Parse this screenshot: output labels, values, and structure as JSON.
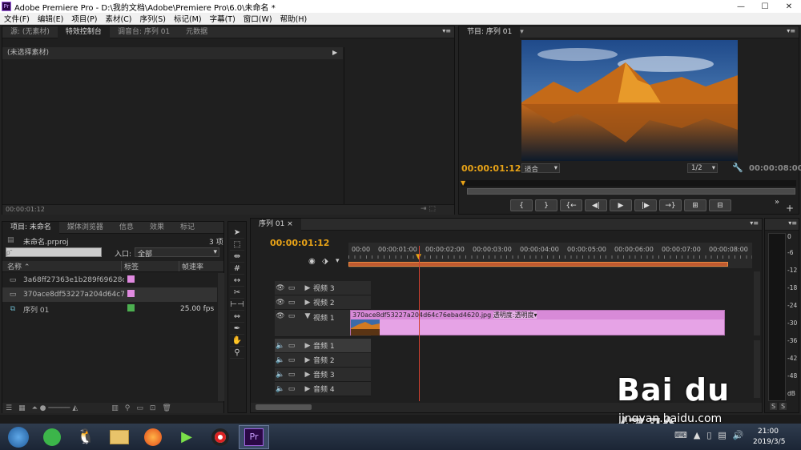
{
  "window": {
    "title": "Adobe Premiere Pro - D:\\我的文档\\Adobe\\Premiere Pro\\6.0\\未命名 *",
    "logo": "Pr",
    "minimize": "—",
    "maximize": "☐",
    "close": "✕"
  },
  "menu": [
    "文件(F)",
    "编辑(E)",
    "项目(P)",
    "素材(C)",
    "序列(S)",
    "标记(M)",
    "字幕(T)",
    "窗口(W)",
    "帮助(H)"
  ],
  "source_panel": {
    "tabs": [
      "源: (无素材)",
      "特效控制台",
      "调音台: 序列 01",
      "元数据"
    ],
    "no_clip": "(未选择素材)",
    "timecode": "00:00:01:12"
  },
  "program_monitor": {
    "tab": "节目: 序列 01",
    "timecode": "00:00:01:12",
    "fit": "适合",
    "ratio": "1/2",
    "duration": "00:00:08:00",
    "buttons": [
      "{",
      "}",
      "{←",
      "◀|",
      "▶",
      "|▶",
      "→}",
      "⊞",
      "⊟"
    ],
    "more": "»",
    "add": "+"
  },
  "project_panel": {
    "tabs": [
      "项目: 未命名",
      "媒体浏览器",
      "信息",
      "效果",
      "标记"
    ],
    "file": "未命名.prproj",
    "count": "3 项",
    "search_placeholder": "ρ˜",
    "entry_label": "入口:",
    "entry_value": "全部",
    "columns": {
      "name": "名称",
      "label": "标签",
      "fps": "帧速率"
    },
    "items": [
      {
        "name": "3a68ff27363e1b289f69628c",
        "color": "#e08ae0",
        "fps": ""
      },
      {
        "name": "370ace8df53227a204d64c7",
        "color": "#e08ae0",
        "fps": ""
      },
      {
        "name": "序列 01",
        "color": "#4caf50",
        "fps": "25.00 fps"
      }
    ]
  },
  "timeline": {
    "tab": "序列 01",
    "timecode": "00:00:01:12",
    "ruler": [
      "00:00",
      "00:00:01:00",
      "00:00:02:00",
      "00:00:03:00",
      "00:00:04:00",
      "00:00:05:00",
      "00:00:06:00",
      "00:00:07:00",
      "00:00:08:00"
    ],
    "video_tracks": [
      "视频 3",
      "视频 2",
      "视频 1"
    ],
    "audio_tracks": [
      "音频 1",
      "音频 2",
      "音频 3",
      "音频 4"
    ],
    "clip": {
      "name": "370ace8df53227a204d64c76ebad4620.jpg",
      "effect": "透明度:透明度▾",
      "color": "#e6a3e6"
    }
  },
  "audio_meter": {
    "labels": [
      "0",
      "-6",
      "-12",
      "-18",
      "-24",
      "-30",
      "-36",
      "-42",
      "-48",
      "dB"
    ],
    "solo": [
      "S",
      "S"
    ]
  },
  "taskbar": {
    "time": "21:00",
    "date": "2019/3/5"
  },
  "watermark": {
    "brand": "Bai du 经验",
    "url": "jingyan.baidu.com"
  }
}
